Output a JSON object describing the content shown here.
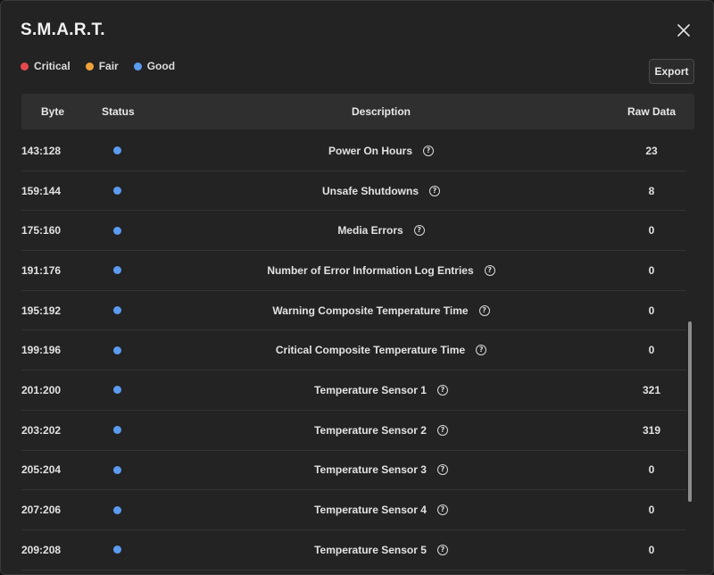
{
  "dialog": {
    "title": "S.M.A.R.T.",
    "export_label": "Export"
  },
  "legend": [
    {
      "label": "Critical",
      "color": "#e5484d"
    },
    {
      "label": "Fair",
      "color": "#f0a23b"
    },
    {
      "label": "Good",
      "color": "#5b9bf0"
    }
  ],
  "table": {
    "headers": {
      "byte": "Byte",
      "status": "Status",
      "description": "Description",
      "raw": "Raw Data"
    },
    "rows": [
      {
        "byte": "143:128",
        "status": "good",
        "description": "Power On Hours",
        "raw": "23"
      },
      {
        "byte": "159:144",
        "status": "good",
        "description": "Unsafe Shutdowns",
        "raw": "8"
      },
      {
        "byte": "175:160",
        "status": "good",
        "description": "Media Errors",
        "raw": "0"
      },
      {
        "byte": "191:176",
        "status": "good",
        "description": "Number of Error Information Log Entries",
        "raw": "0"
      },
      {
        "byte": "195:192",
        "status": "good",
        "description": "Warning Composite Temperature Time",
        "raw": "0"
      },
      {
        "byte": "199:196",
        "status": "good",
        "description": "Critical Composite Temperature Time",
        "raw": "0"
      },
      {
        "byte": "201:200",
        "status": "good",
        "description": "Temperature Sensor 1",
        "raw": "321"
      },
      {
        "byte": "203:202",
        "status": "good",
        "description": "Temperature Sensor 2",
        "raw": "319"
      },
      {
        "byte": "205:204",
        "status": "good",
        "description": "Temperature Sensor 3",
        "raw": "0"
      },
      {
        "byte": "207:206",
        "status": "good",
        "description": "Temperature Sensor 4",
        "raw": "0"
      },
      {
        "byte": "209:208",
        "status": "good",
        "description": "Temperature Sensor 5",
        "raw": "0"
      }
    ]
  },
  "icons": {
    "close": "close-icon",
    "help": "help-circle-icon"
  }
}
